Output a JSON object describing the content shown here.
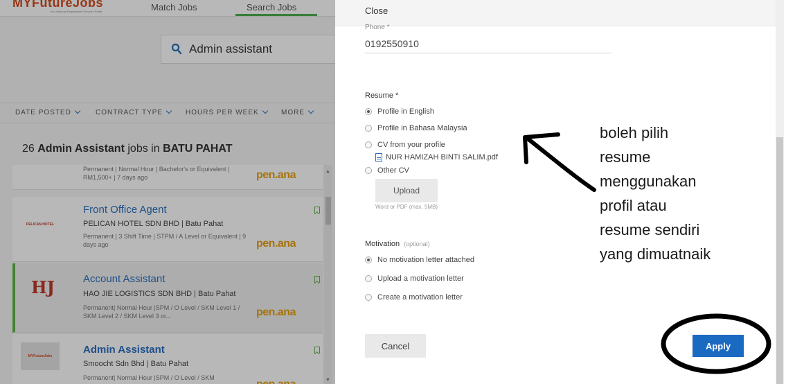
{
  "background_page": {
    "logo_text": "MYFutureJobs",
    "logo_subtext": "Your National Employment Services Portal",
    "nav": {
      "match_jobs": "Match Jobs",
      "search_jobs": "Search Jobs"
    },
    "search": {
      "value": "Admin assistant"
    },
    "filters": [
      "DATE POSTED",
      "CONTRACT TYPE",
      "HOURS PER WEEK",
      "MORE"
    ],
    "results": {
      "count": "26",
      "query": "Admin Assistant",
      "mid": "jobs in",
      "location": "BATU PAHAT"
    },
    "jobs": [
      {
        "title": "",
        "company": "",
        "meta": "Permanent | Normal Hour | Bachelor's or Equivalent | RM1,500+ | 7 days ago",
        "brand": "pen.ana"
      },
      {
        "title": "Front Office Agent",
        "company": "PELICAN HOTEL SDN BHD | Batu Pahat",
        "meta": "Permanent | 3 Shift Time | STPM / A Level or Equivalent | 9 days ago",
        "logo_text": "PELICAN HOTEL",
        "brand": "pen.ana"
      },
      {
        "title": "Account Assistant",
        "company": "HAO JIE LOGISTICS SDN BHD | Batu Pahat",
        "meta": "Permanent| Normal Hour |SPM / O Level / SKM Level 1 / SKM Level 2 / SKM Level 3 or...",
        "logo_text": "HJ",
        "brand": "pen.ana"
      },
      {
        "title": "Admin Assistant",
        "company": "Smoocht Sdn Bhd | Batu Pahat",
        "meta": "Permanent| Normal Hour |SPM / O Level / SKM",
        "logo_text": "MYFutureJobs",
        "brand": "pen.ana"
      }
    ]
  },
  "panel": {
    "close_label": "Close",
    "phone": {
      "label": "Phone *",
      "value": "0192550910"
    },
    "resume": {
      "label": "Resume *",
      "options": [
        {
          "label": "Profile in English",
          "selected": true
        },
        {
          "label": "Profile in Bahasa Malaysia",
          "selected": false
        },
        {
          "label": "CV from your profile",
          "selected": false
        },
        {
          "label": "Other CV",
          "selected": false
        }
      ],
      "file_name": "NUR HAMIZAH BINTI SALIM.pdf",
      "upload_label": "Upload",
      "upload_hint": "Word or PDF (max. 5MB)"
    },
    "motivation": {
      "label": "Motivation",
      "optional": "(optional)",
      "options": [
        {
          "label": "No motivation letter attached",
          "selected": true
        },
        {
          "label": "Upload a motivation letter",
          "selected": false
        },
        {
          "label": "Create a motivation letter",
          "selected": false
        }
      ]
    },
    "cancel_label": "Cancel",
    "apply_label": "Apply"
  },
  "annotation": {
    "lines": [
      "boleh pilih",
      "resume",
      "menggunakan",
      "profil atau",
      "resume sendiri",
      "yang dimuatnaik"
    ],
    "ink_color": "#000000"
  },
  "colors": {
    "accent_blue": "#1b6ac2",
    "link_blue": "#2a6fc0",
    "selected_green": "#5fb548",
    "brand_orange": "#e8a013"
  }
}
